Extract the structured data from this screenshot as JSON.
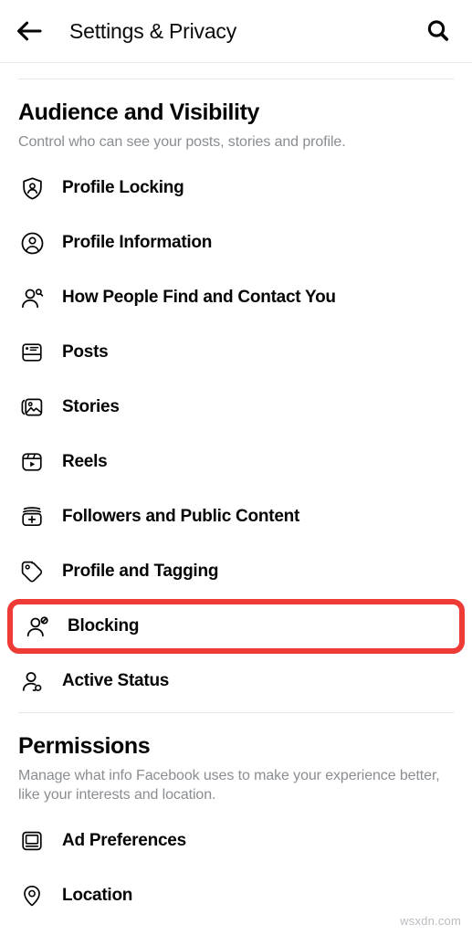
{
  "header": {
    "title": "Settings & Privacy",
    "back_icon": "arrow-left-icon",
    "search_icon": "search-icon"
  },
  "sections": [
    {
      "id": "audience-and-visibility",
      "title": "Audience and Visibility",
      "subtitle": "Control who can see your posts, stories and profile.",
      "items": [
        {
          "label": "Profile Locking",
          "icon": "shield-person-icon",
          "highlighted": false
        },
        {
          "label": "Profile Information",
          "icon": "person-circle-icon",
          "highlighted": false
        },
        {
          "label": "How People Find and Contact You",
          "icon": "person-search-icon",
          "highlighted": false
        },
        {
          "label": "Posts",
          "icon": "post-card-icon",
          "highlighted": false
        },
        {
          "label": "Stories",
          "icon": "photo-stack-icon",
          "highlighted": false
        },
        {
          "label": "Reels",
          "icon": "reels-play-icon",
          "highlighted": false
        },
        {
          "label": "Followers and Public Content",
          "icon": "box-plus-icon",
          "highlighted": false
        },
        {
          "label": "Profile and Tagging",
          "icon": "tag-icon",
          "highlighted": false
        },
        {
          "label": "Blocking",
          "icon": "person-block-icon",
          "highlighted": true
        },
        {
          "label": "Active Status",
          "icon": "person-status-icon",
          "highlighted": false
        }
      ]
    },
    {
      "id": "permissions",
      "title": "Permissions",
      "subtitle": "Manage what info Facebook uses to make your experience better, like your interests and location.",
      "items": [
        {
          "label": "Ad Preferences",
          "icon": "monitor-icon",
          "highlighted": false
        },
        {
          "label": "Location",
          "icon": "location-pin-icon",
          "highlighted": false
        }
      ]
    }
  ],
  "highlight": {
    "color": "#ee3b35",
    "target_label": "Blocking"
  },
  "watermark": {
    "text": "wsxdn.com"
  }
}
